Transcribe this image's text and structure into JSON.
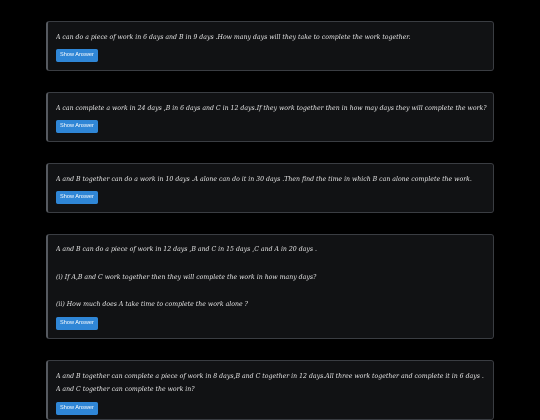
{
  "questions": [
    {
      "lines": [
        "A can do a piece of work in 6 days and B in 9 days .How many days will they take to complete the work together."
      ],
      "button_label": "Show Answer"
    },
    {
      "lines": [
        "A can complete a work in 24 days ,B in 6 days and C in 12 days.If they work together then in how may days they will complete the work?"
      ],
      "button_label": "Show Answer"
    },
    {
      "lines": [
        "A and B together can do a work  in 10 days .A alone can do it in 30 days .Then find the time in which B can alone complete the work."
      ],
      "button_label": "Show Answer"
    },
    {
      "lines": [
        "A and B can do a piece of work in 12 days ,B and C in 15 days ,C and A in 20 days .",
        "(i)  If A,B and C work together then they will complete the work in how many days?",
        "(ii) How much does A take time to complete the work alone ?"
      ],
      "button_label": "Show Answer"
    },
    {
      "lines": [
        "A and B together can complete a piece of work in 8 days,B and C together in 12 days.All three work together and complete it in 6 days .",
        "A and C together can complete the work in?"
      ],
      "button_label": "Show Answer"
    }
  ]
}
